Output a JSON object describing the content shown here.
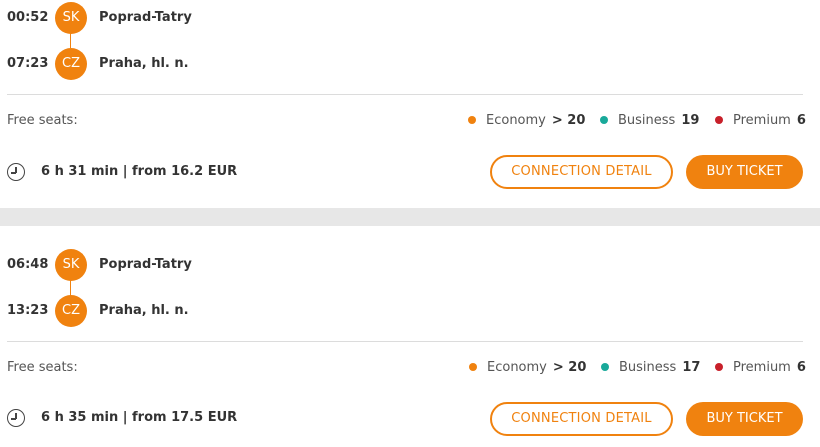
{
  "colors": {
    "accent": "#f0820f",
    "economy": "#f0820f",
    "business": "#19a99a",
    "premium": "#c8202a"
  },
  "labels": {
    "free_seats": "Free seats:",
    "connection_detail": "CONNECTION DETAIL",
    "buy_ticket": "BUY TICKET",
    "economy": "Economy",
    "business": "Business",
    "premium": "Premium"
  },
  "connections": [
    {
      "departure": {
        "time": "00:52",
        "country": "SK",
        "station": "Poprad-Tatry"
      },
      "arrival": {
        "time": "07:23",
        "country": "CZ",
        "station": "Praha, hl. n."
      },
      "seats": {
        "economy": "> 20",
        "business": "19",
        "premium": "6"
      },
      "summary": "6 h 31 min | from 16.2 EUR"
    },
    {
      "departure": {
        "time": "06:48",
        "country": "SK",
        "station": "Poprad-Tatry"
      },
      "arrival": {
        "time": "13:23",
        "country": "CZ",
        "station": "Praha, hl. n."
      },
      "seats": {
        "economy": "> 20",
        "business": "17",
        "premium": "6"
      },
      "summary": "6 h 35 min | from 17.5 EUR"
    }
  ]
}
